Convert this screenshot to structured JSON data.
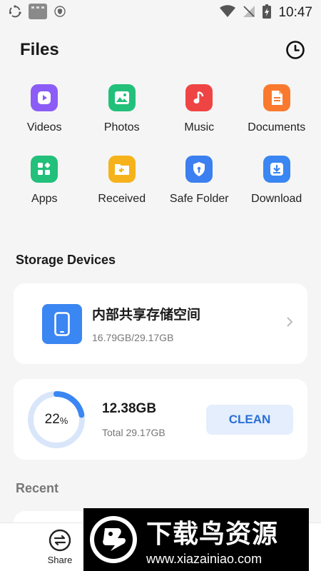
{
  "status_bar": {
    "time": "10:47",
    "icons": [
      "sync-icon",
      "app-thumbnail-icon",
      "shield-icon",
      "wifi-icon",
      "no-signal-icon",
      "battery-charging-icon"
    ]
  },
  "header": {
    "title": "Files",
    "history_icon": "clock-icon"
  },
  "categories": [
    {
      "label": "Videos",
      "color": "#8b5cf6",
      "icon": "play-icon"
    },
    {
      "label": "Photos",
      "color": "#22c07a",
      "icon": "image-icon"
    },
    {
      "label": "Music",
      "color": "#ef4444",
      "icon": "music-note-icon"
    },
    {
      "label": "Documents",
      "color": "#f97a2e",
      "icon": "document-icon"
    },
    {
      "label": "Apps",
      "color": "#22c07a",
      "icon": "apps-icon"
    },
    {
      "label": "Received",
      "color": "#f6b21b",
      "icon": "folder-receive-icon"
    },
    {
      "label": "Safe Folder",
      "color": "#3b7ff0",
      "icon": "shield-lock-icon"
    },
    {
      "label": "Download",
      "color": "#3a86f2",
      "icon": "download-icon"
    }
  ],
  "storage": {
    "section_title": "Storage Devices",
    "device_name": "内部共享存储空间",
    "usage": "16.79GB/29.17GB"
  },
  "cleaner": {
    "percent": "22",
    "percent_unit": "%",
    "percent_value": 22,
    "used": "12.38GB",
    "total": "Total 29.17GB",
    "button": "CLEAN",
    "ring_color": "#3a86f2",
    "track_color": "#d9e6fa"
  },
  "recent": {
    "section_title": "Recent"
  },
  "bottom_nav": {
    "share_label": "Share"
  },
  "watermark": {
    "title": "下载鸟资源",
    "url": "www.xiazainiao.com"
  }
}
